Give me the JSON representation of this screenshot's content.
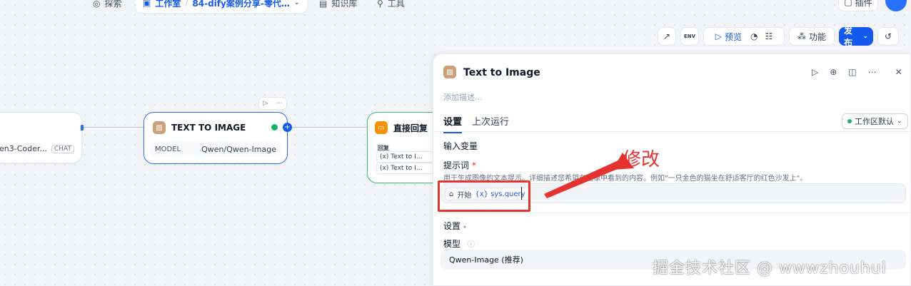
{
  "topnav": {
    "explore": "探索",
    "studio": "工作室",
    "app_name": "84-dify案例分享-零代…",
    "knowledge": "知识库",
    "tools": "工具",
    "plugins": "插件"
  },
  "toolbar": {
    "env_label": "ENV",
    "preview": "预览",
    "features": "功能",
    "publish": "发布"
  },
  "canvas": {
    "left_node": {
      "model": "en3-Coder...",
      "badge": "CHAT"
    },
    "tti_node": {
      "title": "TEXT TO IMAGE",
      "model_label": "MODEL",
      "model_value": "Qwen/Qwen-Image"
    },
    "answer_node": {
      "title": "直接回复",
      "reply_label": "回复",
      "vars": [
        "Text to I...",
        "Text to I..."
      ]
    }
  },
  "panel": {
    "title": "Text to Image",
    "description_placeholder": "添加描述...",
    "tabs": [
      "设置",
      "上次运行"
    ],
    "workspace_badge": "工作区默认",
    "input_vars_label": "输入变量",
    "prompt_label": "提示词",
    "prompt_required": "*",
    "prompt_hint": "用于生成图像的文本提示。详细描述您希望在图像中看到的内容。例如\"一只金色的猫坐在舒适客厅的红色沙发上\"。",
    "chip_source": "开始",
    "chip_var": "{x} sys.query",
    "settings_label": "设置",
    "model_label": "模型",
    "model_value": "Qwen-Image (推荐)"
  },
  "annotation": "修改",
  "watermark": "掘金技术社区 @ wwwzhouhui",
  "colors": {
    "accent": "#155aef",
    "annotation_red": "#e5332f",
    "success": "#17b26a"
  }
}
